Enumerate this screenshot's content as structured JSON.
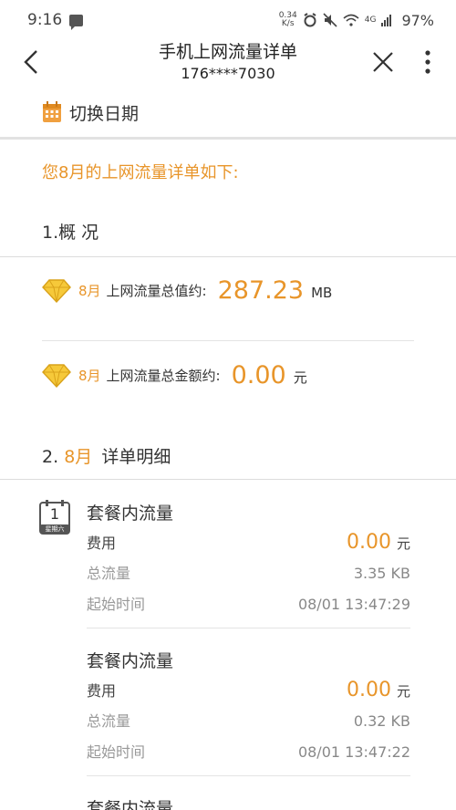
{
  "status_bar": {
    "time": "9:16",
    "speed_value": "0.34",
    "speed_unit": "K/s",
    "network": "4G",
    "battery": "97%"
  },
  "header": {
    "title": "手机上网流量详单",
    "subtitle": "176****7030"
  },
  "date_switch": {
    "label": "切换日期"
  },
  "intro": "您8月的上网流量详单如下:",
  "overview": {
    "heading": "1.概 况",
    "items": [
      {
        "month": "8月",
        "label": "上网流量总值约:",
        "value": "287.23",
        "unit": "MB"
      },
      {
        "month": "8月",
        "label": "上网流量总金额约:",
        "value": "0.00",
        "unit": "元"
      }
    ]
  },
  "detail": {
    "heading_prefix": "2.",
    "heading_month": "8月",
    "heading_suffix": "详单明细",
    "calendar": {
      "day": "1",
      "weekday": "星期六"
    },
    "records": [
      {
        "title": "套餐内流量",
        "fee_label": "费用",
        "fee": "0.00",
        "fee_unit": "元",
        "total_label": "总流量",
        "total": "3.35 KB",
        "start_label": "起始时间",
        "start": "08/01 13:47:29"
      },
      {
        "title": "套餐内流量",
        "fee_label": "费用",
        "fee": "0.00",
        "fee_unit": "元",
        "total_label": "总流量",
        "total": "0.32 KB",
        "start_label": "起始时间",
        "start": "08/01 13:47:22"
      },
      {
        "title": "套餐内流量"
      }
    ]
  },
  "colors": {
    "accent": "#e8952a",
    "text": "#333333",
    "muted": "#999999"
  }
}
